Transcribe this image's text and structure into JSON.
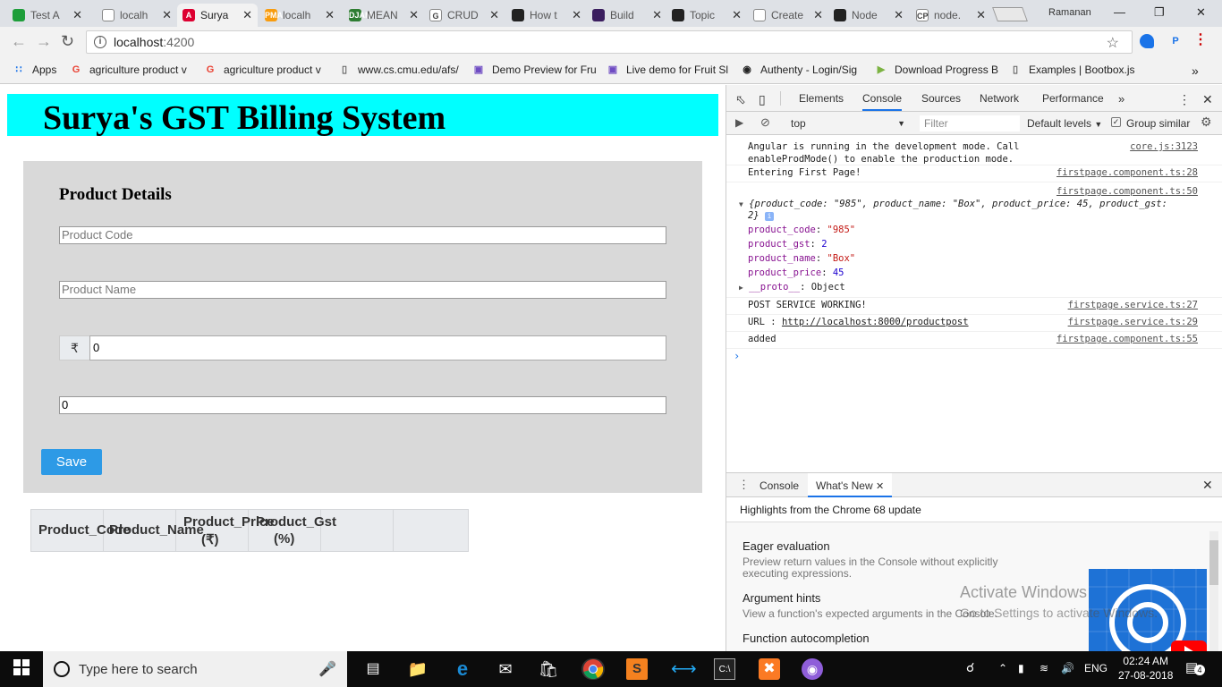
{
  "browser": {
    "tabs": [
      {
        "title": "Test A",
        "fav_color": "#1e9e3a",
        "fav_glyph": "",
        "active": false
      },
      {
        "title": "localh",
        "fav_color": "#ffffff",
        "fav_glyph": "",
        "active": false
      },
      {
        "title": "Surya",
        "fav_color": "#dd0031",
        "fav_glyph": "A",
        "active": true
      },
      {
        "title": "localh",
        "fav_color": "#f89c0e",
        "fav_glyph": "PMA",
        "active": false
      },
      {
        "title": "MEAN",
        "fav_color": "#2e7d32",
        "fav_glyph": "DJAM",
        "active": false
      },
      {
        "title": "CRUD",
        "fav_color": "#ffffff",
        "fav_glyph": "G",
        "active": false
      },
      {
        "title": "How t",
        "fav_color": "#222222",
        "fav_glyph": "",
        "active": false
      },
      {
        "title": "Build",
        "fav_color": "#3b1e5f",
        "fav_glyph": "",
        "active": false
      },
      {
        "title": "Topic",
        "fav_color": "#222222",
        "fav_glyph": "",
        "active": false
      },
      {
        "title": "Create",
        "fav_color": "#ffffff",
        "fav_glyph": "",
        "active": false
      },
      {
        "title": "Node",
        "fav_color": "#222222",
        "fav_glyph": "",
        "active": false
      },
      {
        "title": "node.",
        "fav_color": "#ffffff",
        "fav_glyph": "CP",
        "active": false
      }
    ],
    "profile_name": "Ramanan",
    "url_host": "localhost",
    "url_port": ":4200",
    "bookmarks": [
      {
        "label": "Apps",
        "icon": "apps-icon"
      },
      {
        "label": "agriculture product v",
        "icon": "google-icon"
      },
      {
        "label": "agriculture product v",
        "icon": "google-icon"
      },
      {
        "label": "www.cs.cmu.edu/afs/",
        "icon": "page-icon"
      },
      {
        "label": "Demo Preview for Fru",
        "icon": "envato-icon"
      },
      {
        "label": "Live demo for Fruit Sl",
        "icon": "envato-icon"
      },
      {
        "label": "Authenty - Login/Sig",
        "icon": "github-icon"
      },
      {
        "label": "Download Progress B",
        "icon": "play-icon"
      },
      {
        "label": "Examples | Bootbox.js",
        "icon": "page-icon"
      }
    ]
  },
  "app": {
    "title": "Surya's GST Billing System",
    "form_heading": "Product Details",
    "code_placeholder": "Product Code",
    "name_placeholder": "Product Name",
    "currency_symbol": "₹",
    "price_value": "0",
    "gst_value": "0",
    "save_label": "Save",
    "table_headers": [
      {
        "line1": "Product_Code",
        "line2": ""
      },
      {
        "line1": "Product_Name",
        "line2": ""
      },
      {
        "line1": "Product_Price",
        "line2": "(₹)"
      },
      {
        "line1": "Product_Gst",
        "line2": "(%)"
      },
      {
        "line1": "",
        "line2": ""
      },
      {
        "line1": "",
        "line2": ""
      }
    ]
  },
  "devtools": {
    "tabs": [
      "Elements",
      "Console",
      "Sources",
      "Network",
      "Performance"
    ],
    "active_tab": "Console",
    "context": "top",
    "filter_placeholder": "Filter",
    "levels": "Default levels",
    "group_similar": "Group similar",
    "logs": {
      "angular_msg1": "Angular is running in the development mode. Call",
      "angular_msg2": "enableProdMode() to enable the production mode.",
      "angular_src": "core.js:3123",
      "entering": "Entering First Page!",
      "entering_src": "firstpage.component.ts:28",
      "obj_src": "firstpage.component.ts:50",
      "obj_summary1": "{product_code: \"985\", product_name: \"Box\", product_price: 45, product_gst:",
      "obj_summary2": "2}",
      "prop_code_key": "product_code",
      "prop_code_val": "\"985\"",
      "prop_gst_key": "product_gst",
      "prop_gst_val": "2",
      "prop_name_key": "product_name",
      "prop_name_val": "\"Box\"",
      "prop_price_key": "product_price",
      "prop_price_val": "45",
      "proto_key": "__proto__",
      "proto_val": "Object",
      "post": "POST SERVICE WORKING!",
      "post_src": "firstpage.service.ts:27",
      "url_label": "URL : ",
      "url_value": "http://localhost:8000/productpost",
      "url_src": "firstpage.service.ts:29",
      "added": "added",
      "added_src": "firstpage.component.ts:55"
    },
    "drawer_tabs": [
      "Console",
      "What's New"
    ],
    "whats_new_heading": "Highlights from the Chrome 68 update",
    "whats_new_items": [
      {
        "title": "Eager evaluation",
        "desc": "Preview return values in the Console without explicitly executing expressions."
      },
      {
        "title": "Argument hints",
        "desc": "View a function's expected arguments in the Console."
      },
      {
        "title": "Function autocompletion",
        "desc": ""
      }
    ]
  },
  "watermark": {
    "line1": "Activate Windows",
    "line2": "Go to Settings to activate Windows."
  },
  "taskbar": {
    "search_placeholder": "Type here to search",
    "language": "ENG",
    "time": "02:24 AM",
    "date": "27-08-2018",
    "notification_count": "4"
  }
}
